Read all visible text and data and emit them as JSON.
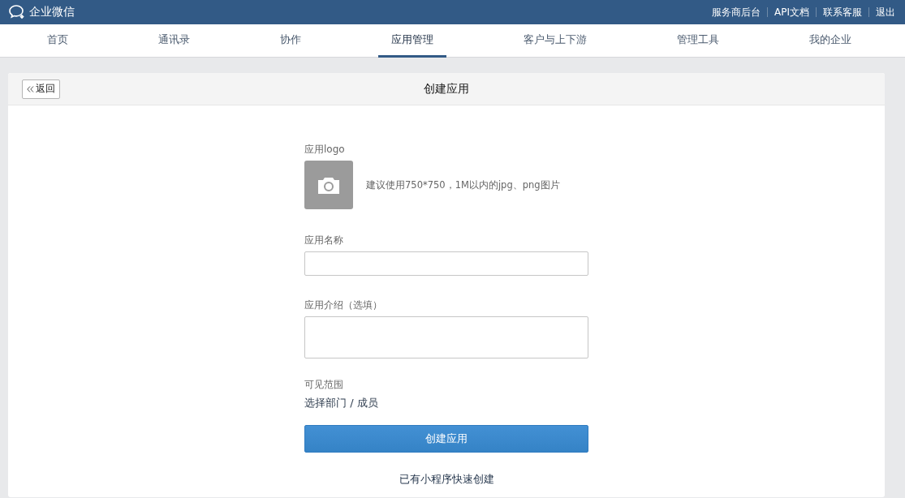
{
  "header": {
    "brand": "企业微信",
    "links": [
      "服务商后台",
      "API文档",
      "联系客服",
      "退出"
    ]
  },
  "tabs": [
    {
      "label": "首页",
      "selected": false
    },
    {
      "label": "通讯录",
      "selected": false
    },
    {
      "label": "协作",
      "selected": false
    },
    {
      "label": "应用管理",
      "selected": true
    },
    {
      "label": "客户与上下游",
      "selected": false
    },
    {
      "label": "管理工具",
      "selected": false
    },
    {
      "label": "我的企业",
      "selected": false
    }
  ],
  "card": {
    "back_button": "返回",
    "title": "创建应用"
  },
  "form": {
    "logo_label": "应用logo",
    "logo_hint": "建议使用750*750，1M以内的jpg、png图片",
    "name_label": "应用名称",
    "intro_label": "应用介绍（选填）",
    "scope_label": "可见范围",
    "scope_link": "选择部门 / 成员",
    "submit": "创建应用",
    "mini_program_link": "已有小程序快速创建"
  }
}
